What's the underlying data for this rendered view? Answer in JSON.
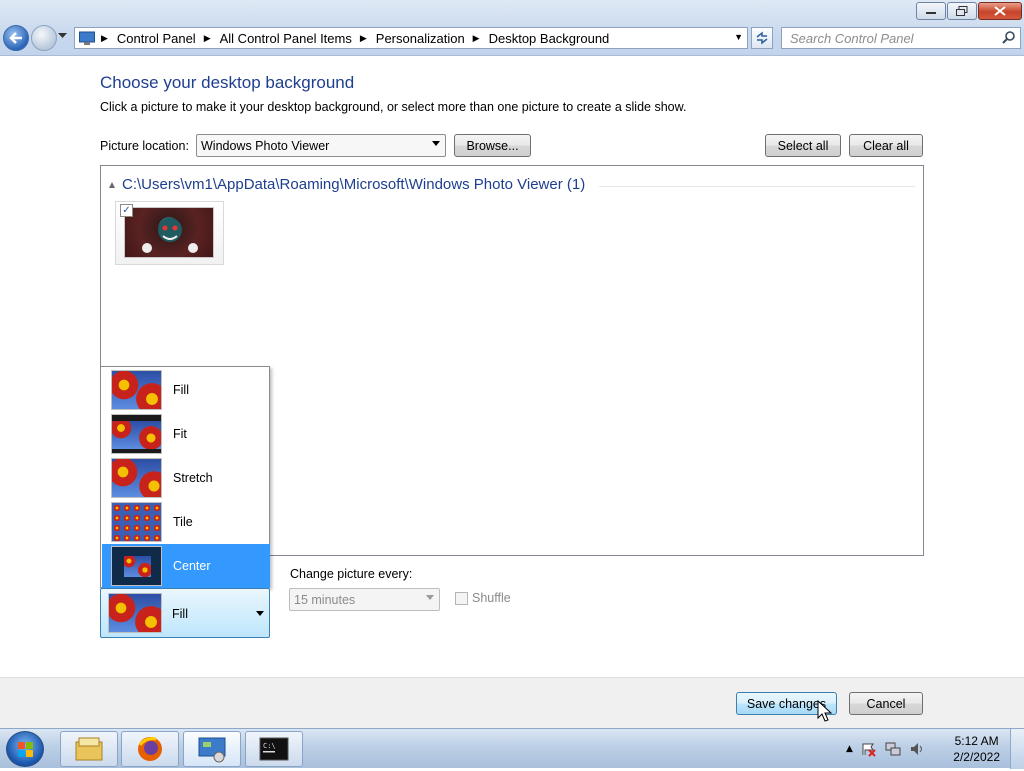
{
  "address": {
    "crumbs": [
      "Control Panel",
      "All Control Panel Items",
      "Personalization",
      "Desktop Background"
    ],
    "search_placeholder": "Search Control Panel"
  },
  "page": {
    "heading": "Choose your desktop background",
    "subtext": "Click a picture to make it your desktop background, or select more than one picture to create a slide show."
  },
  "picture_location": {
    "label": "Picture location:",
    "value": "Windows Photo Viewer",
    "browse_label": "Browse...",
    "select_all_label": "Select all",
    "clear_all_label": "Clear all"
  },
  "gallery": {
    "group_header": "C:\\Users\\vm1\\AppData\\Roaming\\Microsoft\\Windows Photo Viewer (1)",
    "items": [
      {
        "checked": true
      }
    ]
  },
  "picture_position": {
    "options": [
      "Fill",
      "Fit",
      "Stretch",
      "Tile",
      "Center"
    ],
    "highlighted": "Center",
    "selected_label": "Fill"
  },
  "slideshow": {
    "change_label": "Change picture every:",
    "interval_value": "15 minutes",
    "shuffle_label": "Shuffle"
  },
  "footer": {
    "save_label": "Save changes",
    "cancel_label": "Cancel"
  },
  "taskbar": {
    "items": [
      "file-explorer-icon",
      "firefox-icon",
      "control-panel-icon",
      "command-prompt-icon"
    ],
    "time": "5:12 AM",
    "date": "2/2/2022"
  },
  "colors": {
    "heading": "#1e3f8f",
    "selection": "#3399ff"
  }
}
